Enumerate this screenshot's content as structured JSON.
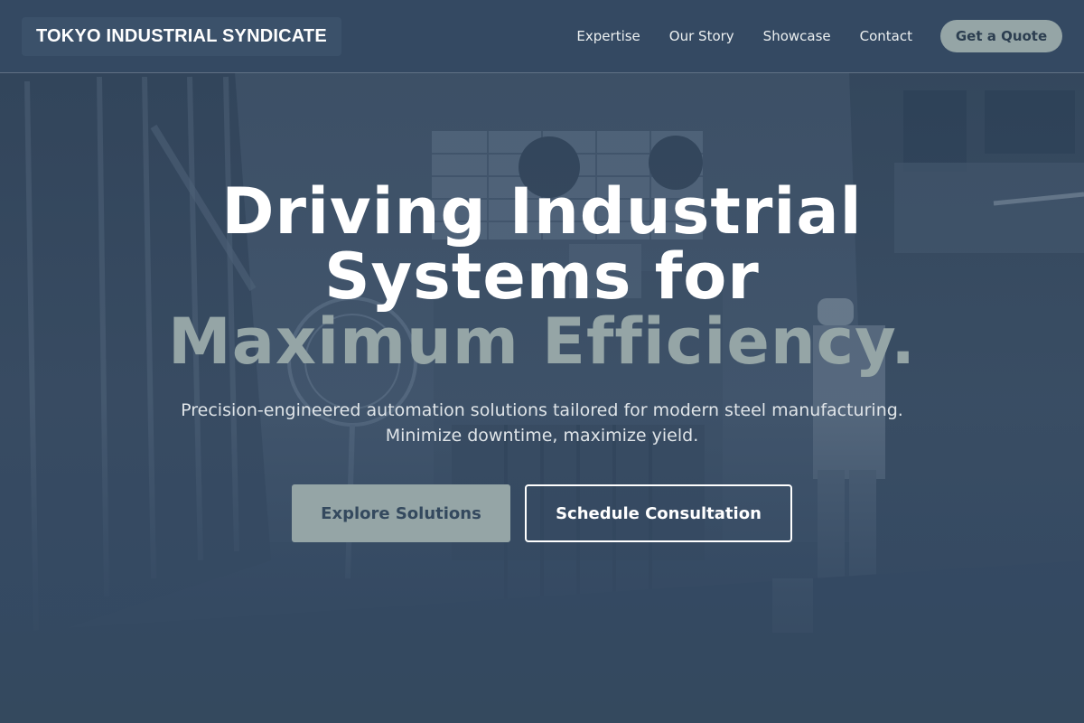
{
  "header": {
    "brand": "TOKYO INDUSTRIAL SYNDICATE",
    "nav": [
      "Expertise",
      "Our Story",
      "Showcase",
      "Contact"
    ],
    "cta": "Get a Quote"
  },
  "hero": {
    "title_line1": "Driving Industrial",
    "title_line2": "Systems for",
    "title_accent": "Maximum Efficiency.",
    "subtitle_line1": "Precision-engineered automation solutions tailored for modern steel manufacturing.",
    "subtitle_line2": "Minimize downtime, maximize yield.",
    "primary_button": "Explore Solutions",
    "secondary_button": "Schedule Consultation"
  },
  "colors": {
    "background": "#34495e",
    "accent": "#95a5a6",
    "text": "#ffffff"
  }
}
